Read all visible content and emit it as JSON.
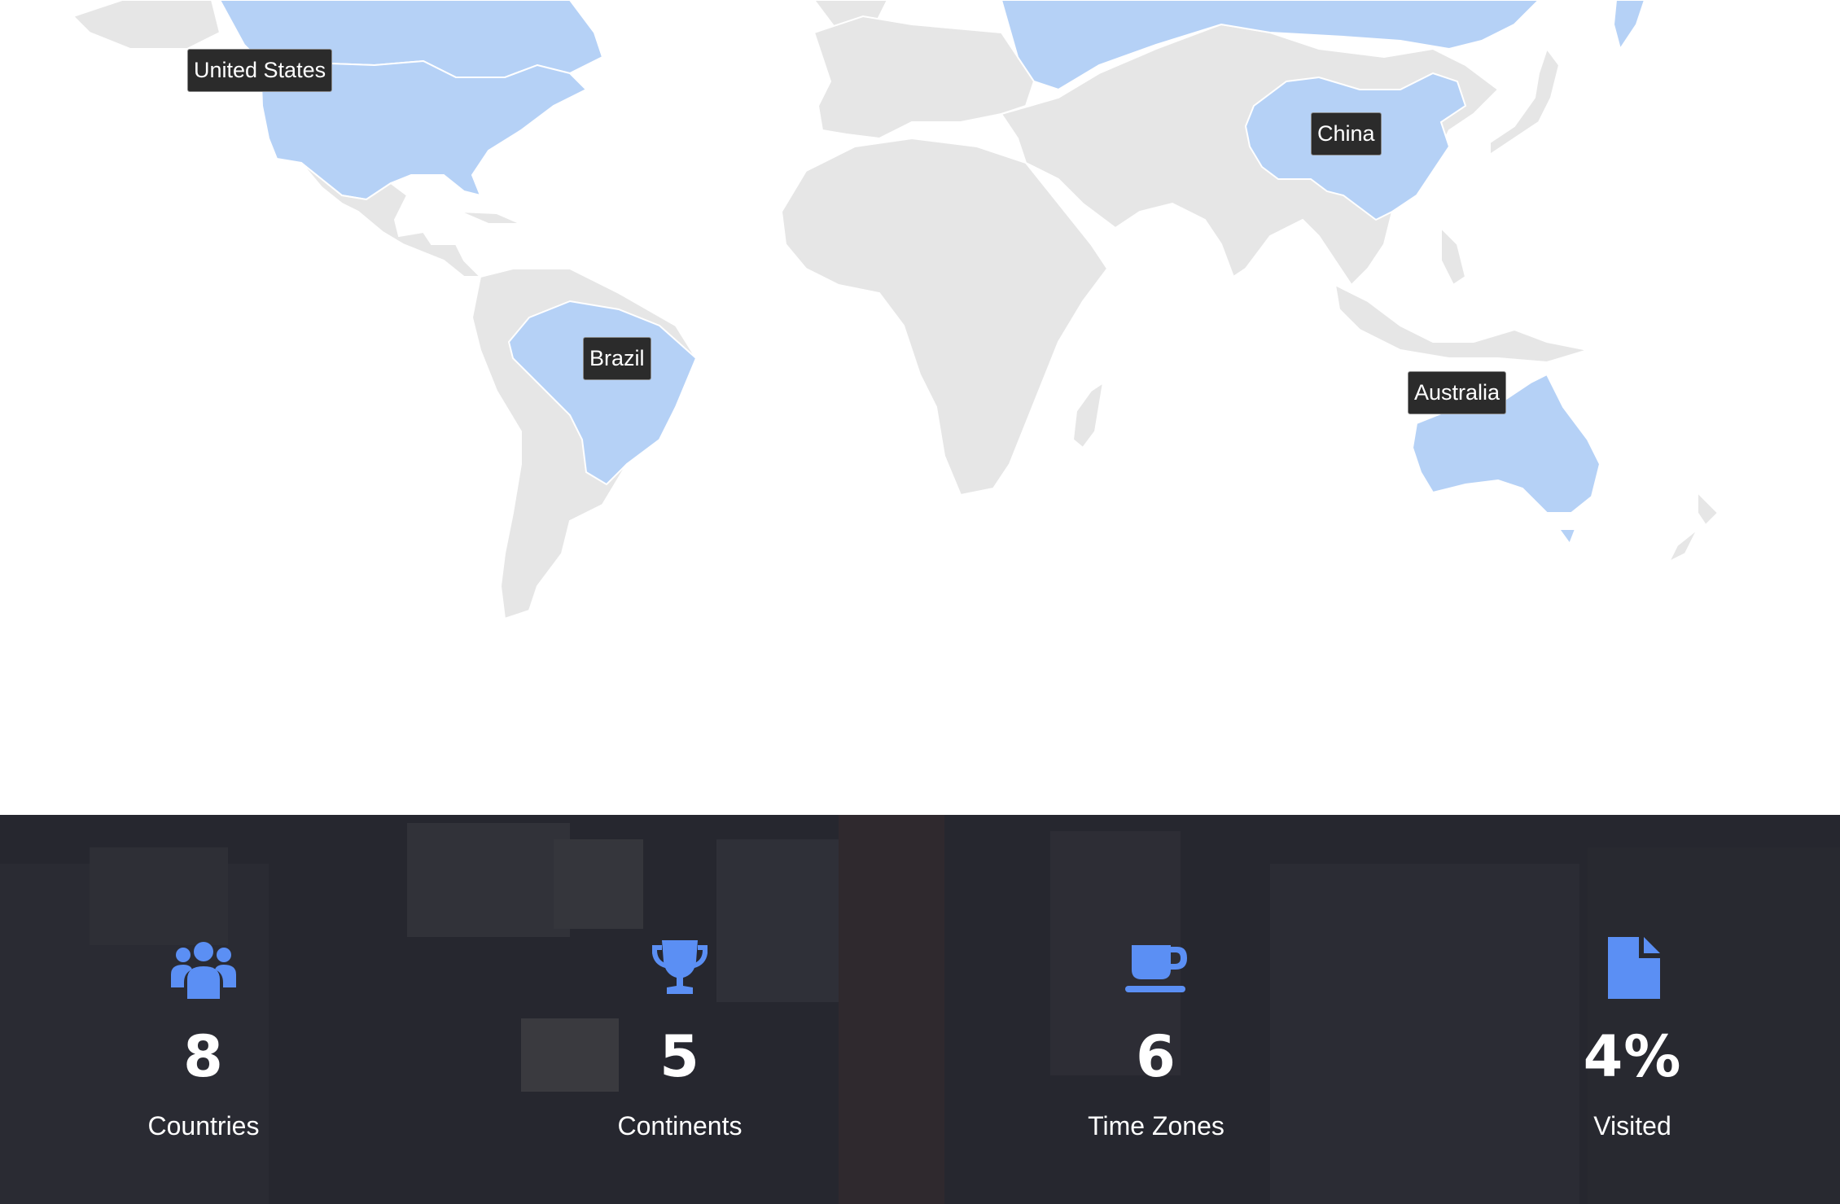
{
  "map": {
    "labels": [
      {
        "id": "united-states",
        "text": "United States"
      },
      {
        "id": "china",
        "text": "China"
      },
      {
        "id": "brazil",
        "text": "Brazil"
      },
      {
        "id": "australia",
        "text": "Australia"
      }
    ],
    "colors": {
      "land": "#e6e6e6",
      "visited": "#b5d1f6",
      "label_bg": "#2b2b2b"
    }
  },
  "stats": {
    "accent": "#5b8ff4",
    "items": [
      {
        "icon": "users-icon",
        "value": "8",
        "label": "Countries"
      },
      {
        "icon": "trophy-icon",
        "value": "5",
        "label": "Continents"
      },
      {
        "icon": "coffee-cup-icon",
        "value": "6",
        "label": "Time Zones"
      },
      {
        "icon": "document-icon",
        "value": "4%",
        "label": "Visited"
      }
    ]
  }
}
